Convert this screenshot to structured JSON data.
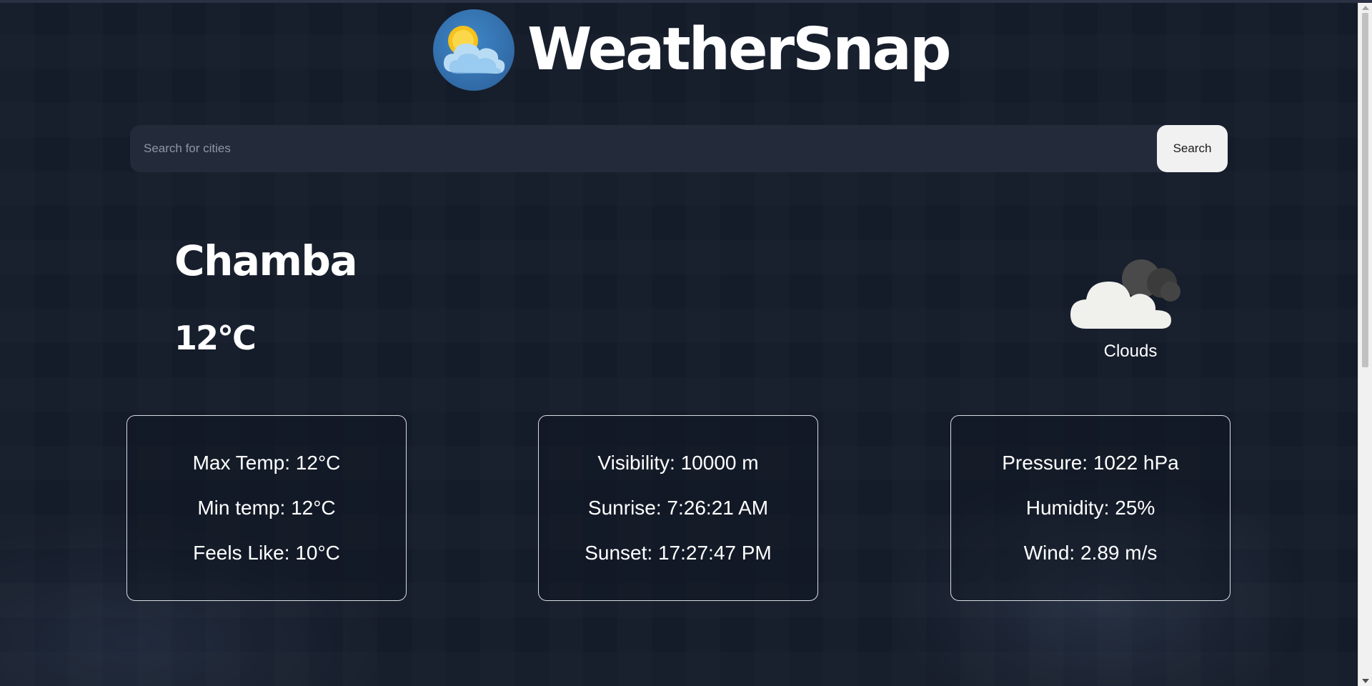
{
  "app": {
    "title": "WeatherSnap",
    "logo_icon": "sun-cloud-logo-icon"
  },
  "search": {
    "placeholder": "Search for cities",
    "value": "",
    "button_label": "Search"
  },
  "weather": {
    "city": "Chamba",
    "temperature": "12°C",
    "condition": "Clouds",
    "condition_icon": "clouds-icon"
  },
  "cards": [
    {
      "rows": [
        "Max Temp: 12°C",
        "Min temp: 12°C",
        "Feels Like: 10°C"
      ]
    },
    {
      "rows": [
        "Visibility: 10000 m",
        "Sunrise: 7:26:21 AM",
        "Sunset: 17:27:47 PM"
      ]
    },
    {
      "rows": [
        "Pressure: 1022 hPa",
        "Humidity: 25%",
        "Wind: 2.89 m/s"
      ]
    }
  ],
  "colors": {
    "background": "#141b29",
    "search_bar": "#232b3a",
    "search_button": "#f1f1f1",
    "text": "#ffffff",
    "card_border": "#d8dce3",
    "logo_blue": "#3f86c8"
  }
}
